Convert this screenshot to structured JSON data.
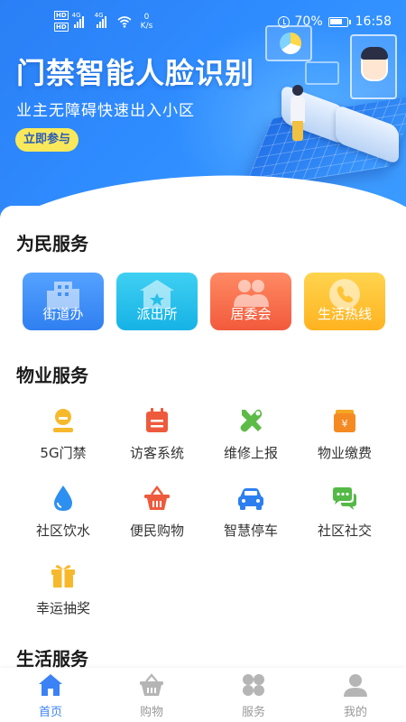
{
  "status_bar": {
    "hd1": "HD",
    "hd2": "HD",
    "net1": "4G",
    "net2": "4G",
    "speed_value": "0",
    "speed_unit": "K/s",
    "battery": "70%",
    "time": "16:58"
  },
  "banner": {
    "title": "门禁智能人脸识别",
    "subtitle": "业主无障碍快速出入小区",
    "join_label": "立即参与"
  },
  "sections": {
    "public": {
      "title": "为民服务",
      "cards": [
        {
          "label": "街道办",
          "icon": "building-icon",
          "color": "#3f8ff5"
        },
        {
          "label": "派出所",
          "icon": "police-station-icon",
          "color": "#22bde9"
        },
        {
          "label": "居委会",
          "icon": "people-icon",
          "color": "#f46a47"
        },
        {
          "label": "生活热线",
          "icon": "phone-icon",
          "color": "#ffc133"
        }
      ]
    },
    "property": {
      "title": "物业服务",
      "items": [
        {
          "label": "5G门禁",
          "icon": "access-control-icon"
        },
        {
          "label": "访客系统",
          "icon": "visitor-calendar-icon"
        },
        {
          "label": "维修上报",
          "icon": "repair-tools-icon"
        },
        {
          "label": "物业缴费",
          "icon": "payment-icon"
        },
        {
          "label": "社区饮水",
          "icon": "water-drop-icon"
        },
        {
          "label": "便民购物",
          "icon": "shopping-basket-icon"
        },
        {
          "label": "智慧停车",
          "icon": "car-icon"
        },
        {
          "label": "社区社交",
          "icon": "chat-icon"
        },
        {
          "label": "幸运抽奖",
          "icon": "gift-icon"
        }
      ]
    },
    "life": {
      "title": "生活服务"
    }
  },
  "tabbar": {
    "tabs": [
      {
        "label": "首页",
        "icon": "home-icon",
        "active": true
      },
      {
        "label": "购物",
        "icon": "basket-icon",
        "active": false
      },
      {
        "label": "服务",
        "icon": "services-icon",
        "active": false
      },
      {
        "label": "我的",
        "icon": "user-icon",
        "active": false
      }
    ]
  },
  "colors": {
    "brand_blue": "#2f86f6",
    "active_tab": "#3b82f6",
    "inactive_tab": "#999999",
    "join_button": "#f9e95a"
  }
}
